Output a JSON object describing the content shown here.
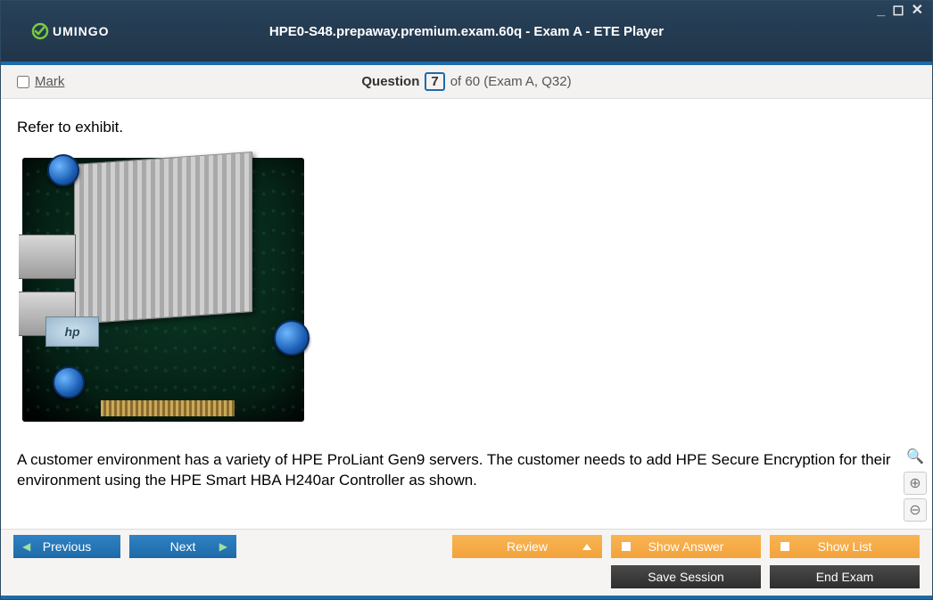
{
  "window": {
    "title": "HPE0-S48.prepaway.premium.exam.60q - Exam A - ETE Player",
    "brand": "UMINGO"
  },
  "subheader": {
    "mark_label": "Mark",
    "question_word": "Question",
    "question_number": "7",
    "question_rest": "of 60 (Exam A, Q32)"
  },
  "content": {
    "intro": "Refer to exhibit.",
    "hp_badge": "hp",
    "paragraph": "A customer environment has a variety of HPE ProLiant Gen9 servers. The customer needs to add HPE Secure Encryption for their environment using the HPE Smart HBA H240ar Controller as shown."
  },
  "footer": {
    "previous": "Previous",
    "next": "Next",
    "review": "Review",
    "show_answer": "Show Answer",
    "show_list": "Show List",
    "save_session": "Save Session",
    "end_exam": "End Exam"
  },
  "icons": {
    "zoom_reset": "🔍",
    "zoom_in": "⊕",
    "zoom_out": "⊖"
  }
}
